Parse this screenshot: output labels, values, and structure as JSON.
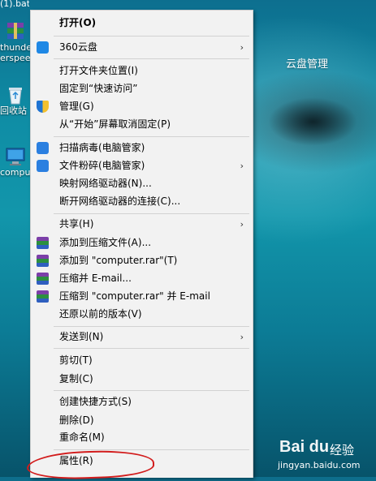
{
  "desktop": {
    "top_file": "(1).bat",
    "icons": [
      {
        "label": "thunder",
        "label2": "erspee",
        "icon": "winrar-icon"
      },
      {
        "label": "回收站",
        "icon": "recycle-bin-icon"
      },
      {
        "label": "compu",
        "icon": "computer-icon"
      }
    ],
    "cloud_label": "云盘管理"
  },
  "context_menu": {
    "open": "打开(O)",
    "cloud360": "360云盘",
    "open_location": "打开文件夹位置(I)",
    "pin_quick": "固定到“快速访问”",
    "manage": "管理(G)",
    "unpin_start": "从“开始”屏幕取消固定(P)",
    "scan_virus": "扫描病毒(电脑管家)",
    "shred": "文件粉碎(电脑管家)",
    "map_drive": "映射网络驱动器(N)...",
    "disconnect_drive": "断开网络驱动器的连接(C)...",
    "share": "共享(H)",
    "add_archive": "添加到压缩文件(A)...",
    "add_computer_rar": "添加到 \"computer.rar\"(T)",
    "compress_email": "压缩并 E-mail...",
    "compress_computer_email": "压缩到 \"computer.rar\" 并 E-mail",
    "restore_versions": "还原以前的版本(V)",
    "send_to": "发送到(N)",
    "cut": "剪切(T)",
    "copy": "复制(C)",
    "create_shortcut": "创建快捷方式(S)",
    "delete": "删除(D)",
    "rename": "重命名(M)",
    "properties": "属性(R)",
    "arrow": "›"
  },
  "watermark": {
    "logo": "Bai du",
    "brand": "经验",
    "url": "jingyan.baidu.com"
  },
  "colors": {
    "menu_bg": "#f2f2f2",
    "annotation_red": "#d21c1c",
    "desktop_teal": "#0f8da5"
  }
}
